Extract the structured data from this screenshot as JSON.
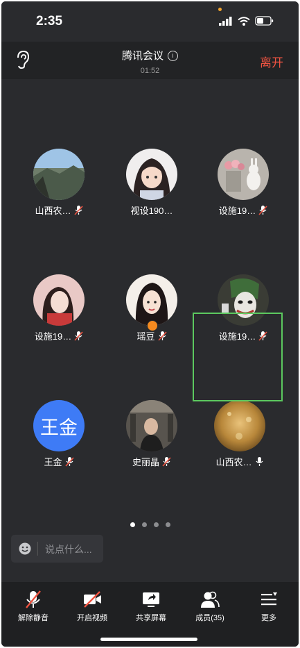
{
  "status": {
    "time": "2:35"
  },
  "header": {
    "title": "腾讯会议",
    "duration": "01:52",
    "leave_label": "离开"
  },
  "participants": [
    {
      "name": "山西农…",
      "mic": "muted"
    },
    {
      "name": "视设190…",
      "mic": "none"
    },
    {
      "name": "设施19…",
      "mic": "muted"
    },
    {
      "name": "设施19…",
      "mic": "muted"
    },
    {
      "name": "瑶豆",
      "mic": "muted"
    },
    {
      "name": "设施19…",
      "mic": "muted"
    },
    {
      "name": "王金",
      "mic": "muted",
      "avatar_text": "王金"
    },
    {
      "name": "史丽晶",
      "mic": "muted"
    },
    {
      "name": "山西农…",
      "mic": "active"
    }
  ],
  "pager": {
    "pages": 4,
    "current": 1
  },
  "chat": {
    "placeholder": "说点什么..."
  },
  "toolbar": [
    {
      "label": "解除静音",
      "icon": "mic-muted-icon"
    },
    {
      "label": "开启视频",
      "icon": "video-off-icon"
    },
    {
      "label": "共享屏幕",
      "icon": "share-screen-icon"
    },
    {
      "label": "成员(35)",
      "icon": "members-icon"
    },
    {
      "label": "更多",
      "icon": "more-menu-icon"
    }
  ],
  "colors": {
    "leave": "#ef5341",
    "active_border": "#5cc95f",
    "avatar_blue": "#3e7bf6"
  }
}
